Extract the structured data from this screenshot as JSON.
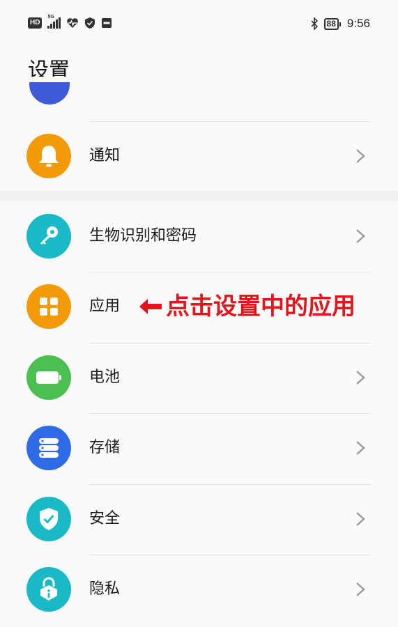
{
  "status_bar": {
    "hd_label": "HD",
    "network_label": "5G",
    "battery_level": "88",
    "time": "9:56",
    "icons": [
      "hd-icon",
      "signal-icon",
      "health-icon",
      "shield-icon",
      "hms-icon",
      "bluetooth-icon",
      "battery-icon"
    ]
  },
  "page": {
    "title": "设置"
  },
  "settings": {
    "notifications": {
      "label": "通知",
      "icon": "bell-icon",
      "color": "#f39a0b"
    },
    "biometrics": {
      "label": "生物识别和密码",
      "icon": "key-icon",
      "color": "#1bb8c6"
    },
    "apps": {
      "label": "应用",
      "icon": "apps-grid-icon",
      "color": "#f39a0b"
    },
    "battery": {
      "label": "电池",
      "icon": "battery-icon",
      "color": "#4cbf52"
    },
    "storage": {
      "label": "存储",
      "icon": "storage-icon",
      "color": "#2f6be6"
    },
    "security": {
      "label": "安全",
      "icon": "shield-check-icon",
      "color": "#1bb8c6"
    },
    "privacy": {
      "label": "隐私",
      "icon": "lock-info-icon",
      "color": "#1bb8c6"
    }
  },
  "annotation": {
    "text": "点击设置中的应用",
    "color": "#e3141b"
  }
}
